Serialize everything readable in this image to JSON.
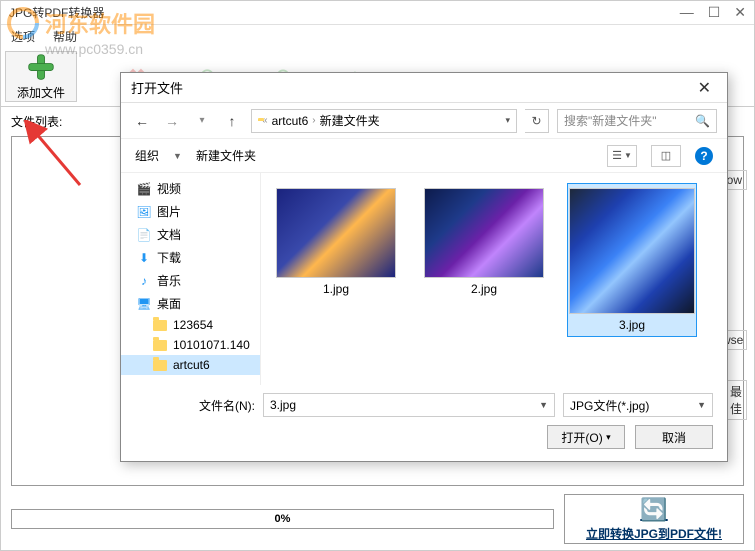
{
  "main": {
    "title": "JPG转PDF转换器",
    "menubar": {
      "item1": "选项",
      "item2": "帮助"
    },
    "toolbar": {
      "add_file_label": "添加文件"
    },
    "file_list_label": "文件列表:",
    "progress_text": "0%",
    "convert_label": "立即转换JPG到PDF文件!",
    "right_labels": {
      "ow": "ow",
      "wse": "wse",
      "best": "最佳"
    }
  },
  "watermark": {
    "text": "河东软件园",
    "url": "www.pc0359.cn"
  },
  "dialog": {
    "title": "打开文件",
    "breadcrumb": {
      "seg1": "artcut6",
      "seg2": "新建文件夹"
    },
    "search_placeholder": "搜索\"新建文件夹\"",
    "organize": "组织",
    "new_folder": "新建文件夹",
    "tree": {
      "video": "视频",
      "pictures": "图片",
      "documents": "文档",
      "downloads": "下载",
      "music": "音乐",
      "desktop": "桌面",
      "folder1": "123654",
      "folder2": "10101071.140",
      "folder3": "artcut6"
    },
    "files": {
      "f1": "1.jpg",
      "f2": "2.jpg",
      "f3": "3.jpg"
    },
    "filename_label": "文件名(N):",
    "filename_value": "3.jpg",
    "filetype_value": "JPG文件(*.jpg)",
    "open_btn": "打开(O)",
    "cancel_btn": "取消"
  }
}
